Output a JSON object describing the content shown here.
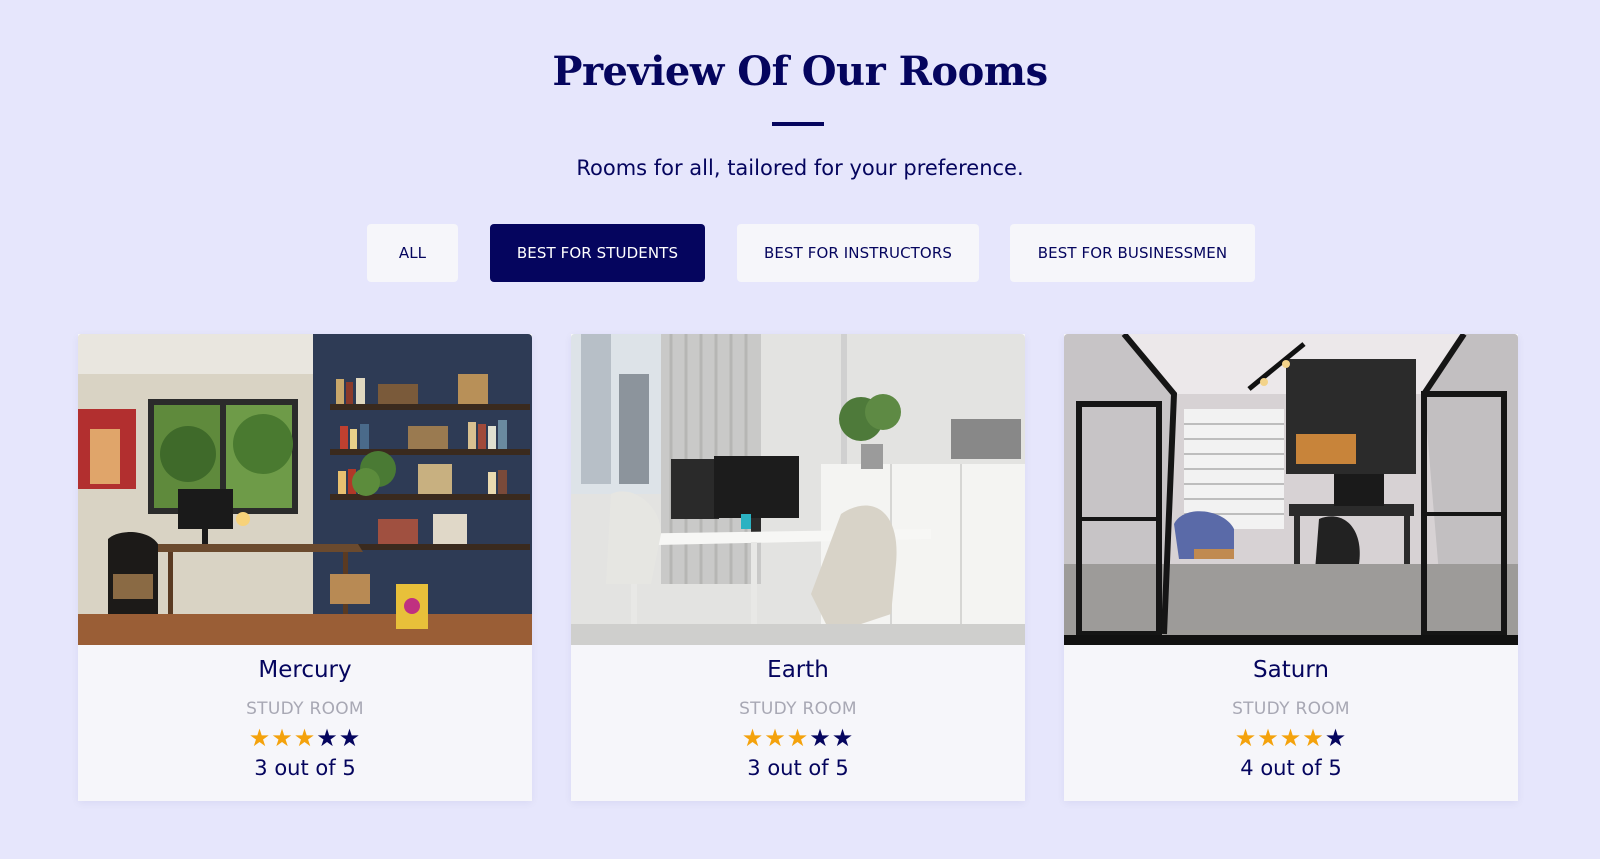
{
  "section": {
    "title": "Preview Of Our Rooms",
    "subtitle": "Rooms for all, tailored for your preference."
  },
  "filters": [
    {
      "label": "ALL",
      "active": false
    },
    {
      "label": "BEST FOR STUDENTS",
      "active": true
    },
    {
      "label": "BEST FOR INSTRUCTORS",
      "active": false
    },
    {
      "label": "BEST FOR BUSINESSMEN",
      "active": false
    }
  ],
  "rooms": [
    {
      "name": "Mercury",
      "type": "STUDY ROOM",
      "stars": 3,
      "max_stars": 5,
      "rating_text": "3 out of 5"
    },
    {
      "name": "Earth",
      "type": "STUDY ROOM",
      "stars": 3,
      "max_stars": 5,
      "rating_text": "3 out of 5"
    },
    {
      "name": "Saturn",
      "type": "STUDY ROOM",
      "stars": 4,
      "max_stars": 5,
      "rating_text": "4 out of 5"
    }
  ],
  "colors": {
    "background": "#e6e6fc",
    "primary": "#05055e",
    "star_filled": "#f4a20c",
    "card": "#f6f6fa",
    "muted": "#a8a8b4"
  },
  "icons": {
    "star": "star-icon"
  }
}
